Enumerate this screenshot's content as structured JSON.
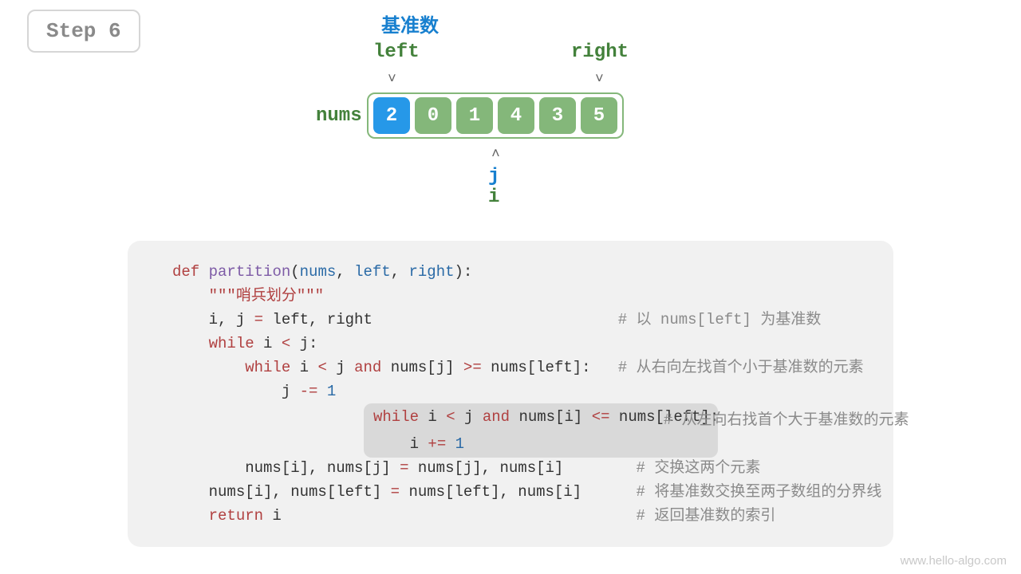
{
  "step": {
    "label": "Step 6"
  },
  "labels": {
    "pivot": "基准数",
    "left": "left",
    "right": "right",
    "nums": "nums",
    "j": "j",
    "i": "i"
  },
  "array": {
    "pivot_index": 0,
    "cells": [
      "2",
      "0",
      "1",
      "4",
      "3",
      "5"
    ]
  },
  "pointers": {
    "left_col": 0,
    "right_col": 5,
    "ij_col": 3
  },
  "code": {
    "lines": [
      {
        "t": "def",
        "raw": "def partition(nums, left, right):"
      },
      {
        "t": "doc",
        "raw": "    \"\"\"哨兵划分\"\"\""
      },
      {
        "t": "stmt",
        "raw": "    i, j = left, right",
        "comment": "# 以 nums[left] 为基准数"
      },
      {
        "t": "stmt",
        "raw": "    while i < j:"
      },
      {
        "t": "stmt",
        "raw": "        while i < j and nums[j] >= nums[left]:",
        "comment": "# 从右向左找首个小于基准数的元素"
      },
      {
        "t": "stmt",
        "raw": "            j -= 1"
      },
      {
        "t": "hl",
        "raw": "while i < j and nums[i] <= nums[left]:",
        "comment": "# 从左向右找首个大于基准数的元素"
      },
      {
        "t": "hl2",
        "raw": "    i += 1"
      },
      {
        "t": "stmt",
        "raw": "        nums[i], nums[j] = nums[j], nums[i]",
        "comment": "# 交换这两个元素"
      },
      {
        "t": "stmt",
        "raw": "    nums[i], nums[left] = nums[left], nums[i]",
        "comment": "# 将基准数交换至两子数组的分界线"
      },
      {
        "t": "stmt",
        "raw": "    return i",
        "comment": "# 返回基准数的索引"
      }
    ]
  },
  "watermark": "www.hello-algo.com"
}
